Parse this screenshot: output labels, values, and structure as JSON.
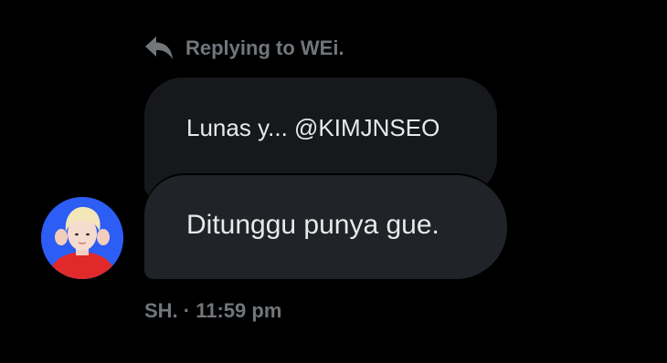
{
  "reply_header": {
    "icon": "reply-arrow-icon",
    "text": "Replying to WEi."
  },
  "quoted_message": {
    "text": "Lunas y... @KIMJNSEO"
  },
  "message": {
    "text": "Ditunggu punya gue."
  },
  "meta": {
    "text": "SH. · 11:59 pm"
  },
  "colors": {
    "background": "#000000",
    "quoted_bubble": "#16181c",
    "message_bubble": "#202327",
    "text_primary": "#e7e9ea",
    "text_secondary": "#71767b"
  }
}
